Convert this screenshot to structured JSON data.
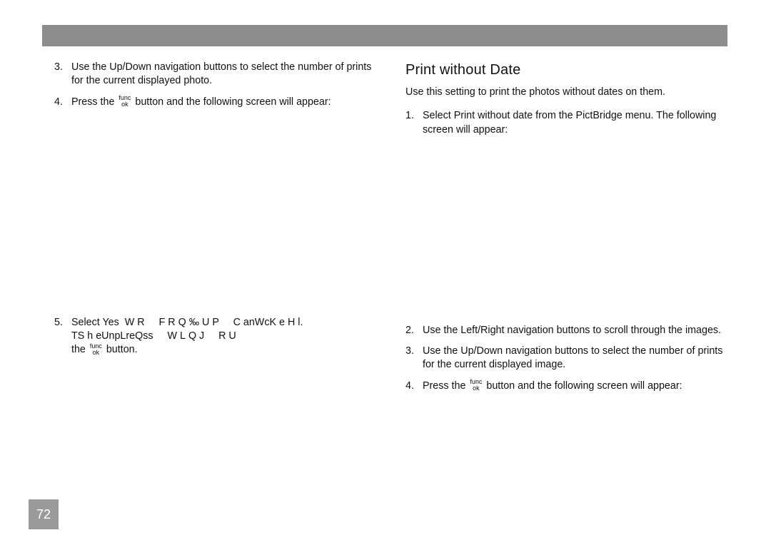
{
  "page_number": "72",
  "left": {
    "steps": [
      {
        "num": "3.",
        "text": "Use the Up/Down navigation buttons to select the number of prints for the current displayed photo."
      },
      {
        "num": "4.",
        "prefix": "Press the ",
        "suffix": " button and the following screen will appear:"
      },
      {
        "num": "5.",
        "line1_a": "Select Yes",
        "line1_b": "WR FRQ‰UP C",
        "line1_c": "anW",
        "line1_d": "c",
        "line1_e": "KeH",
        "line1_f": "l. T",
        "line1_g": "Sh",
        "line1_h": "eU",
        "line1_i": "npLr",
        "line1_j": "eQs",
        "line1_k": "s WLQJ",
        "line1_l": "RU",
        "line2_a": "the ",
        "line2_b": " button."
      }
    ]
  },
  "right": {
    "heading": "Print without Date",
    "intro": "Use this setting to print the photos without dates on them.",
    "steps": [
      {
        "num": "1.",
        "text": "Select Print without date from the  PictBridge menu. The following screen will appear:"
      },
      {
        "num": "2.",
        "text": "Use the Left/Right navigation buttons to scroll through the images."
      },
      {
        "num": "3.",
        "text": "Use the Up/Down navigation buttons to select the number of prints for the current displayed image."
      },
      {
        "num": "4.",
        "prefix": "Press the ",
        "suffix": " button and the following screen will appear:"
      }
    ]
  },
  "funcok": {
    "top": "func",
    "bot": "ok"
  }
}
